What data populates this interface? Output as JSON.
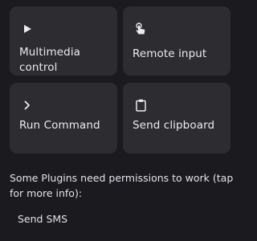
{
  "plugins": [
    {
      "id": "multimedia",
      "label": "Multimedia control",
      "icon": "play-icon"
    },
    {
      "id": "remote",
      "label": "Remote input",
      "icon": "touch-icon"
    },
    {
      "id": "run",
      "label": "Run Command",
      "icon": "chevron-right-icon"
    },
    {
      "id": "clipboard",
      "label": "Send clipboard",
      "icon": "clipboard-icon"
    }
  ],
  "permissions_note": "Some Plugins need permissions to work (tap for more info):",
  "permission_items": [
    "Send SMS"
  ],
  "colors": {
    "background": "#1b1a1f",
    "card": "#2d2c31",
    "text": "#ece9ef"
  }
}
